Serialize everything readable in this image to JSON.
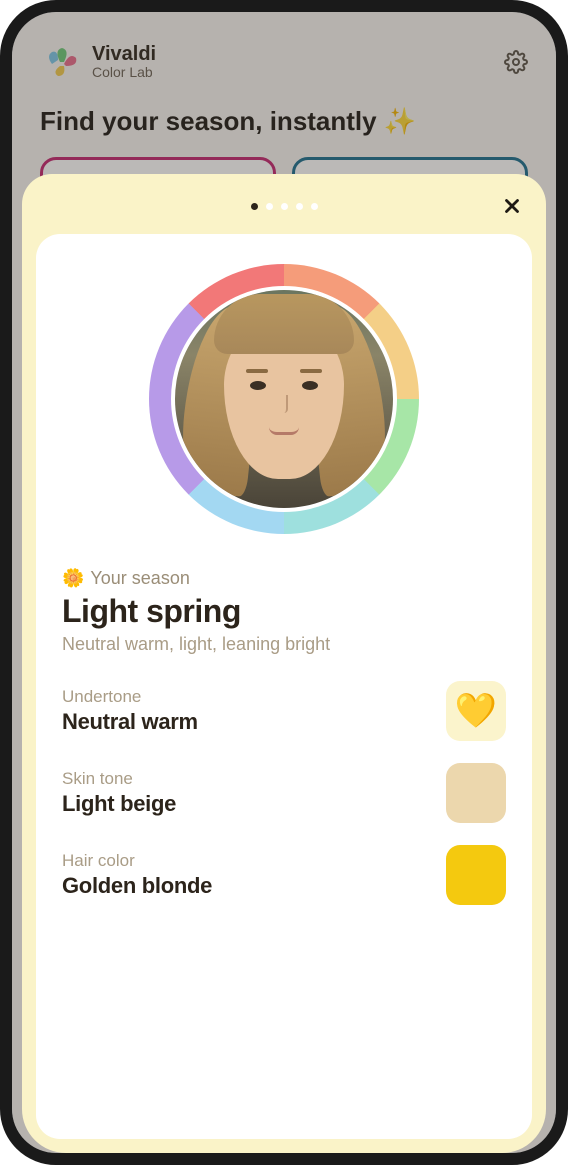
{
  "brand": {
    "name": "Vivaldi",
    "subtitle": "Color Lab"
  },
  "headline": "Find your season, instantly ✨",
  "pager": {
    "count": 5,
    "active": 0
  },
  "season": {
    "label": "Your season",
    "emoji": "🌼",
    "name": "Light spring",
    "description": "Neutral warm, light, leaning bright"
  },
  "attributes": [
    {
      "label": "Undertone",
      "value": "Neutral warm",
      "swatch_type": "heart",
      "swatch_emoji": "💛"
    },
    {
      "label": "Skin tone",
      "value": "Light beige",
      "swatch_type": "beige",
      "swatch_emoji": ""
    },
    {
      "label": "Hair color",
      "value": "Golden blonde",
      "swatch_type": "gold",
      "swatch_emoji": ""
    }
  ]
}
